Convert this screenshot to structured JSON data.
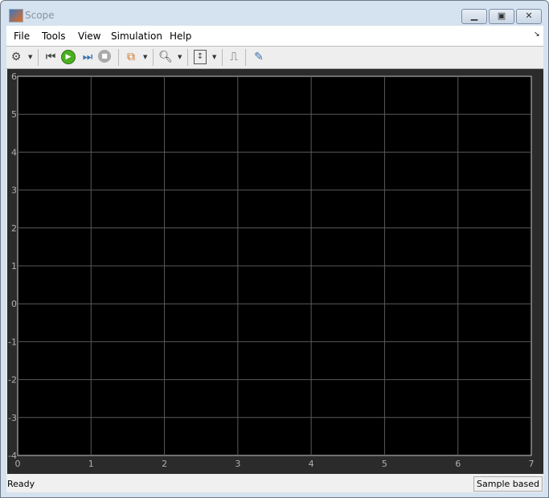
{
  "window": {
    "title": "Scope",
    "minimize_icon": "minimize-icon",
    "maximize_icon": "maximize-icon",
    "close_icon": "close-icon"
  },
  "menu": [
    "File",
    "Tools",
    "View",
    "Simulation",
    "Help"
  ],
  "toolbar": [
    "gear-icon",
    "step-back-icon",
    "run-icon",
    "step-forward-icon",
    "stop-icon",
    "signal-select-icon",
    "zoom-icon",
    "autoscale-icon",
    "trigger-icon",
    "measure-icon"
  ],
  "status": {
    "left": "Ready",
    "right": "Sample based"
  },
  "chart_data": {
    "type": "line",
    "series": [],
    "xlim": [
      0,
      7
    ],
    "ylim": [
      -4,
      6
    ],
    "xticks": [
      "0",
      "1",
      "2",
      "3",
      "4",
      "5",
      "6",
      "7"
    ],
    "yticks": [
      "-4",
      "-3",
      "-2",
      "-1",
      "0",
      "1",
      "2",
      "3",
      "4",
      "5",
      "6"
    ],
    "grid": true,
    "colors": {
      "background": "#000000",
      "frame": "#2b2b2b",
      "grid": "#5a5a5a",
      "tick_text": "#b0b0b0"
    }
  }
}
